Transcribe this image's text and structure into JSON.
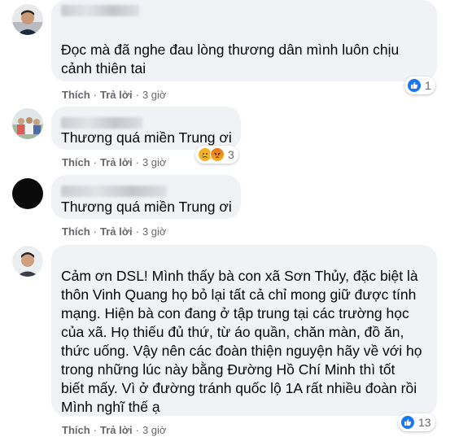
{
  "actions": {
    "like": "Thích",
    "reply": "Trả lời",
    "sep": "·"
  },
  "comments": [
    {
      "lines": [
        "Đọc mà đã nghe đau lòng thương dân mình luôn chịu",
        "cảnh thiên tai"
      ],
      "time": "3 giờ",
      "reaction_count": "1"
    },
    {
      "lines": [
        "Thương quá miền Trung ơi"
      ],
      "time": "3 giờ",
      "reaction_count": "3"
    },
    {
      "lines": [
        "Thương quá miền Trung ơi"
      ],
      "time": "3 giờ"
    },
    {
      "lines": [
        "Cảm ơn DSL! Mình thấy bà con xã Sơn Thủy, đặc biệt là",
        "thôn Vinh Quang họ bỏ lại tất cả chỉ mong giữ được tính",
        "mạng. Hiện bà con đang ở tập trung tại các trường học",
        "của xã. Họ thiếu đủ thứ, từ áo quần, chăn màn, đồ ăn,",
        "thức uống. Vậy nên các đoàn thiện nguyện hãy về với họ",
        "trong những lúc này bằng Đường Hồ Chí Minh thì tốt",
        "biết mấy. Vì ở đường tránh quốc lộ 1A rất nhiều đoàn rồi",
        "Mình nghĩ thế ạ"
      ],
      "time": "3 giờ",
      "reaction_count": "13"
    }
  ]
}
